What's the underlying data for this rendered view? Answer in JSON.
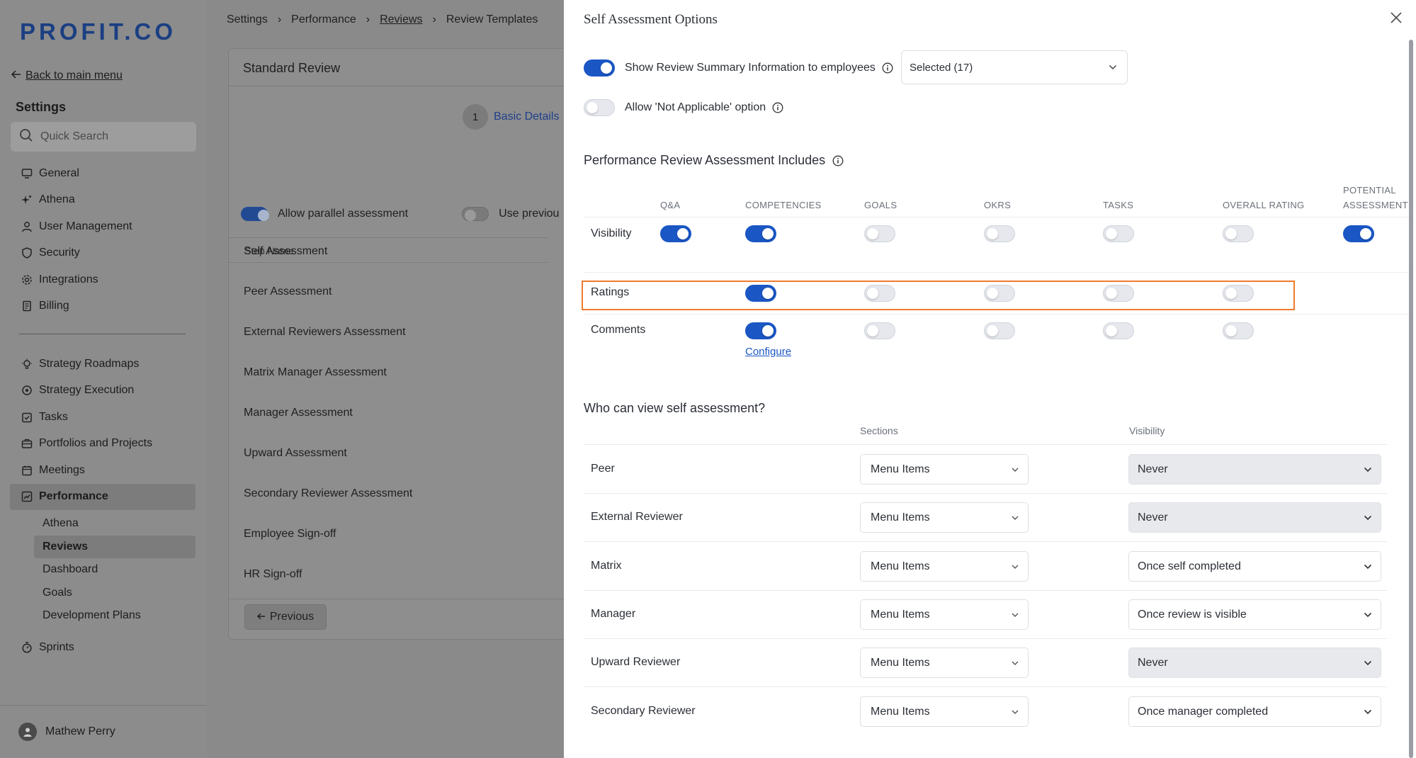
{
  "sidebar": {
    "logo": "PROFIT.CO",
    "back_link": "Back to main menu",
    "title": "Settings",
    "search_placeholder": "Quick Search",
    "items_top": [
      {
        "label": "General",
        "icon": "monitor-icon"
      },
      {
        "label": "Athena",
        "icon": "sparkle-icon"
      },
      {
        "label": "User Management",
        "icon": "user-icon"
      },
      {
        "label": "Security",
        "icon": "shield-icon"
      },
      {
        "label": "Integrations",
        "icon": "gear-icon"
      },
      {
        "label": "Billing",
        "icon": "receipt-icon"
      }
    ],
    "items_bottom": [
      {
        "label": "Strategy Roadmaps",
        "icon": "bulb-icon"
      },
      {
        "label": "Strategy Execution",
        "icon": "target-icon"
      },
      {
        "label": "Tasks",
        "icon": "checkbox-icon"
      },
      {
        "label": "Portfolios and Projects",
        "icon": "briefcase-icon"
      },
      {
        "label": "Meetings",
        "icon": "calendar-icon"
      },
      {
        "label": "Performance",
        "icon": "chart-icon",
        "active": true
      }
    ],
    "performance_sub": [
      {
        "label": "Athena"
      },
      {
        "label": "Reviews",
        "active": true
      },
      {
        "label": "Dashboard"
      },
      {
        "label": "Goals"
      },
      {
        "label": "Development Plans"
      }
    ],
    "sprints": "Sprints",
    "user_name": "Mathew Perry"
  },
  "main": {
    "breadcrumb": [
      "Settings",
      "Performance",
      "Reviews",
      "Review Templates"
    ],
    "card_title": "Standard Review",
    "step_number": "1",
    "step_label": "Basic Details",
    "parallel_label": "Allow parallel assessment",
    "use_previous_label": "Use previou",
    "step_name_header": "Step Name",
    "steps": [
      "Self Assessment",
      "Peer Assessment",
      "External Reviewers Assessment",
      "Matrix Manager Assessment",
      "Manager Assessment",
      "Upward Assessment",
      "Secondary Reviewer Assessment",
      "Employee Sign-off",
      "HR Sign-off"
    ],
    "previous_button": "Previous"
  },
  "drawer": {
    "title": "Self Assessment Options",
    "show_summary_label": "Show Review Summary Information to employees",
    "show_summary_on": true,
    "summary_select": "Selected (17)",
    "allow_na_label": "Allow 'Not Applicable' option",
    "allow_na_on": false,
    "includes_title": "Performance Review Assessment Includes",
    "columns": [
      "Q&A",
      "COMPETENCIES",
      "GOALS",
      "OKRS",
      "TASKS",
      "OVERALL RATING",
      "POTENTIAL ASSESSMENT"
    ],
    "rows": [
      {
        "label": "Visibility",
        "values": [
          true,
          true,
          false,
          false,
          false,
          false,
          true
        ]
      },
      {
        "label": "Ratings",
        "values": [
          null,
          true,
          false,
          false,
          false,
          false,
          null
        ]
      },
      {
        "label": "Comments",
        "values": [
          null,
          true,
          false,
          false,
          false,
          false,
          null
        ]
      }
    ],
    "configure_link": "Configure",
    "who_title": "Who can view self assessment?",
    "sections_header": "Sections",
    "visibility_header": "Visibility",
    "who_rows": [
      {
        "role": "Peer",
        "section": "Menu Items",
        "visibility": "Never",
        "grey": true
      },
      {
        "role": "External Reviewer",
        "section": "Menu Items",
        "visibility": "Never",
        "grey": true
      },
      {
        "role": "Matrix",
        "section": "Menu Items",
        "visibility": "Once self completed",
        "grey": false
      },
      {
        "role": "Manager",
        "section": "Menu Items",
        "visibility": "Once review is visible",
        "grey": false
      },
      {
        "role": "Upward Reviewer",
        "section": "Menu Items",
        "visibility": "Never",
        "grey": true
      },
      {
        "role": "Secondary Reviewer",
        "section": "Menu Items",
        "visibility": "Once manager completed",
        "grey": false
      }
    ]
  },
  "colors": {
    "accent": "#1a56c4",
    "highlight": "#f07b2d",
    "logo": "#1b3f82"
  }
}
